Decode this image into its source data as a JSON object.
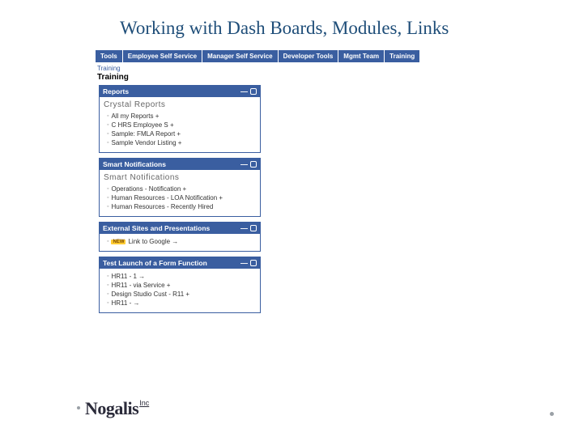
{
  "slide": {
    "title": "Working with Dash Boards, Modules, Links"
  },
  "nav": {
    "tabs": [
      "Tools",
      "Employee Self Service",
      "Manager Self Service",
      "Developer Tools",
      "Mgmt Team",
      "Training"
    ]
  },
  "breadcrumb": "Training",
  "page_heading": "Training",
  "modules": [
    {
      "title": "Reports",
      "subhead": "Crystal Reports",
      "items": [
        {
          "label": "All my Reports +"
        },
        {
          "label": "C HRS Employee S +"
        },
        {
          "label": "Sample: FMLA Report +"
        },
        {
          "label": "Sample Vendor Listing +"
        }
      ]
    },
    {
      "title": "Smart Notifications",
      "subhead": "Smart Notifications",
      "items": [
        {
          "label": "Operations - Notification +"
        },
        {
          "label": "Human Resources - LOA Notification +"
        },
        {
          "label": "Human Resources - Recently Hired"
        }
      ]
    },
    {
      "title": "External Sites and Presentations",
      "subhead": "",
      "items": [
        {
          "badge": "NEW",
          "label": "Link to Google →"
        }
      ]
    },
    {
      "title": "Test Launch of a Form Function",
      "subhead": "",
      "items": [
        {
          "label": "HR11 - 1 →"
        },
        {
          "label": "HR11 - via Service +"
        },
        {
          "label": "Design Studio Cust - R11 +"
        },
        {
          "label": "HR11 - →"
        }
      ]
    }
  ],
  "logo": {
    "name": "Nogalis",
    "suffix": "Inc"
  }
}
